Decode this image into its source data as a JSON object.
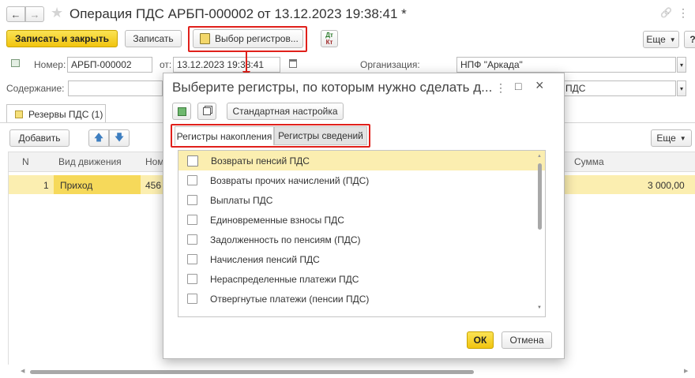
{
  "header": {
    "title": "Операция ПДС АРБП-000002 от 13.12.2023 19:38:41 *",
    "nav_back": "←",
    "nav_forward": "→",
    "star": "★",
    "link_icon": "🔗",
    "more_icon": "⋮"
  },
  "toolbar": {
    "save_close_label": "Записать и закрыть",
    "save_label": "Записать",
    "select_registers_label": "Выбор регистров...",
    "dtkt_label_top": "Дт",
    "dtkt_label_bottom": "Кт",
    "more_label": "Еще",
    "help_label": "?"
  },
  "form": {
    "number_label": "Номер:",
    "number_value": "АРБП-000002",
    "date_label": "от:",
    "date_value": "13.12.2023 19:38:41",
    "org_label": "Организация:",
    "org_value": "НПФ \"Аркада\"",
    "content_label": "Содержание:",
    "content_value": "",
    "second_field_value": "ПДС"
  },
  "tab": {
    "label": "Резервы ПДС (1)"
  },
  "table_toolbar": {
    "add_label": "Добавить",
    "more_label": "Еще"
  },
  "table": {
    "headers": {
      "n": "N",
      "movement": "Вид движения",
      "nom": "Ном",
      "sum": "Сумма"
    },
    "rows": [
      {
        "n": "1",
        "movement": "Приход",
        "nom": "456",
        "sum": "3 000,00"
      }
    ]
  },
  "dialog": {
    "title": "Выберите регистры, по которым нужно сделать д...",
    "more_icon": "⋮",
    "maximize_icon": "□",
    "close_icon": "×",
    "std_settings_label": "Стандартная настройка",
    "tabs": [
      {
        "label": "Регистры накопления"
      },
      {
        "label": "Регистры сведений"
      }
    ],
    "items": [
      {
        "label": "Возвраты пенсий ПДС"
      },
      {
        "label": "Возвраты прочих начислений (ПДС)"
      },
      {
        "label": "Выплаты ПДС"
      },
      {
        "label": "Единовременные взносы ПДС"
      },
      {
        "label": "Задолженность по пенсиям (ПДС)"
      },
      {
        "label": "Начисления пенсий ПДС"
      },
      {
        "label": "Нераспределенные платежи ПДС"
      },
      {
        "label": "Отвергнутые платежи (пенсии ПДС)"
      }
    ],
    "ok_label": "ОК",
    "cancel_label": "Отмена"
  },
  "colors": {
    "accent_yellow": "#f5d52a",
    "selection": "#fbeeb0",
    "highlight_red": "#e0201b"
  }
}
